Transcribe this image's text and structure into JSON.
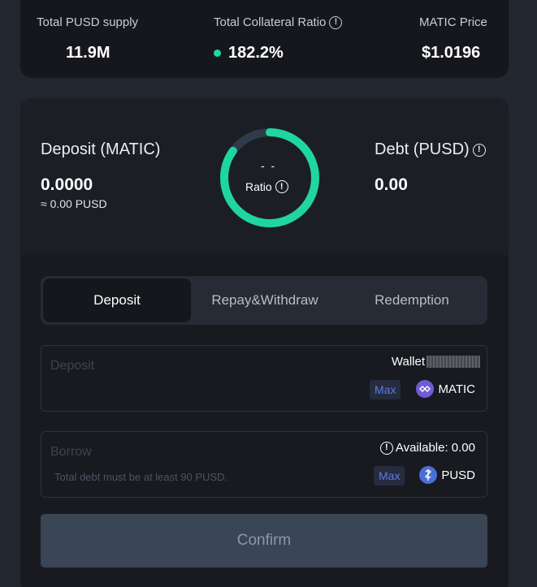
{
  "stats": {
    "supply_label": "Total PUSD supply",
    "supply_value": "11.9M",
    "ratio_label": "Total Collateral Ratio",
    "ratio_value": "182.2%",
    "price_label": "MATIC Price",
    "price_value": "$1.0196"
  },
  "position": {
    "deposit_label": "Deposit (MATIC)",
    "deposit_value": "0.0000",
    "deposit_sub": "≈ 0.00 PUSD",
    "debt_label": "Debt (PUSD)",
    "debt_value": "0.00",
    "ratio_dash": "- -",
    "ratio_label": "Ratio",
    "ring_fill": 0.85
  },
  "tabs": [
    {
      "label": "Deposit",
      "active": true
    },
    {
      "label": "Repay&Withdraw",
      "active": false
    },
    {
      "label": "Redemption",
      "active": false
    }
  ],
  "deposit_field": {
    "placeholder": "Deposit",
    "wallet_label": "Wallet",
    "max_label": "Max",
    "token": "MATIC"
  },
  "borrow_field": {
    "placeholder": "Borrow",
    "available_label": "Available: 0.00",
    "hint": "Total debt must be at least 90 PUSD.",
    "max_label": "Max",
    "token": "PUSD"
  },
  "confirm_label": "Confirm",
  "colors": {
    "accent_green": "#1ed69e",
    "max_blue": "#5b7be6",
    "matic_purple": "#6f5bd6",
    "pusd_blue": "#4a6fd6"
  }
}
